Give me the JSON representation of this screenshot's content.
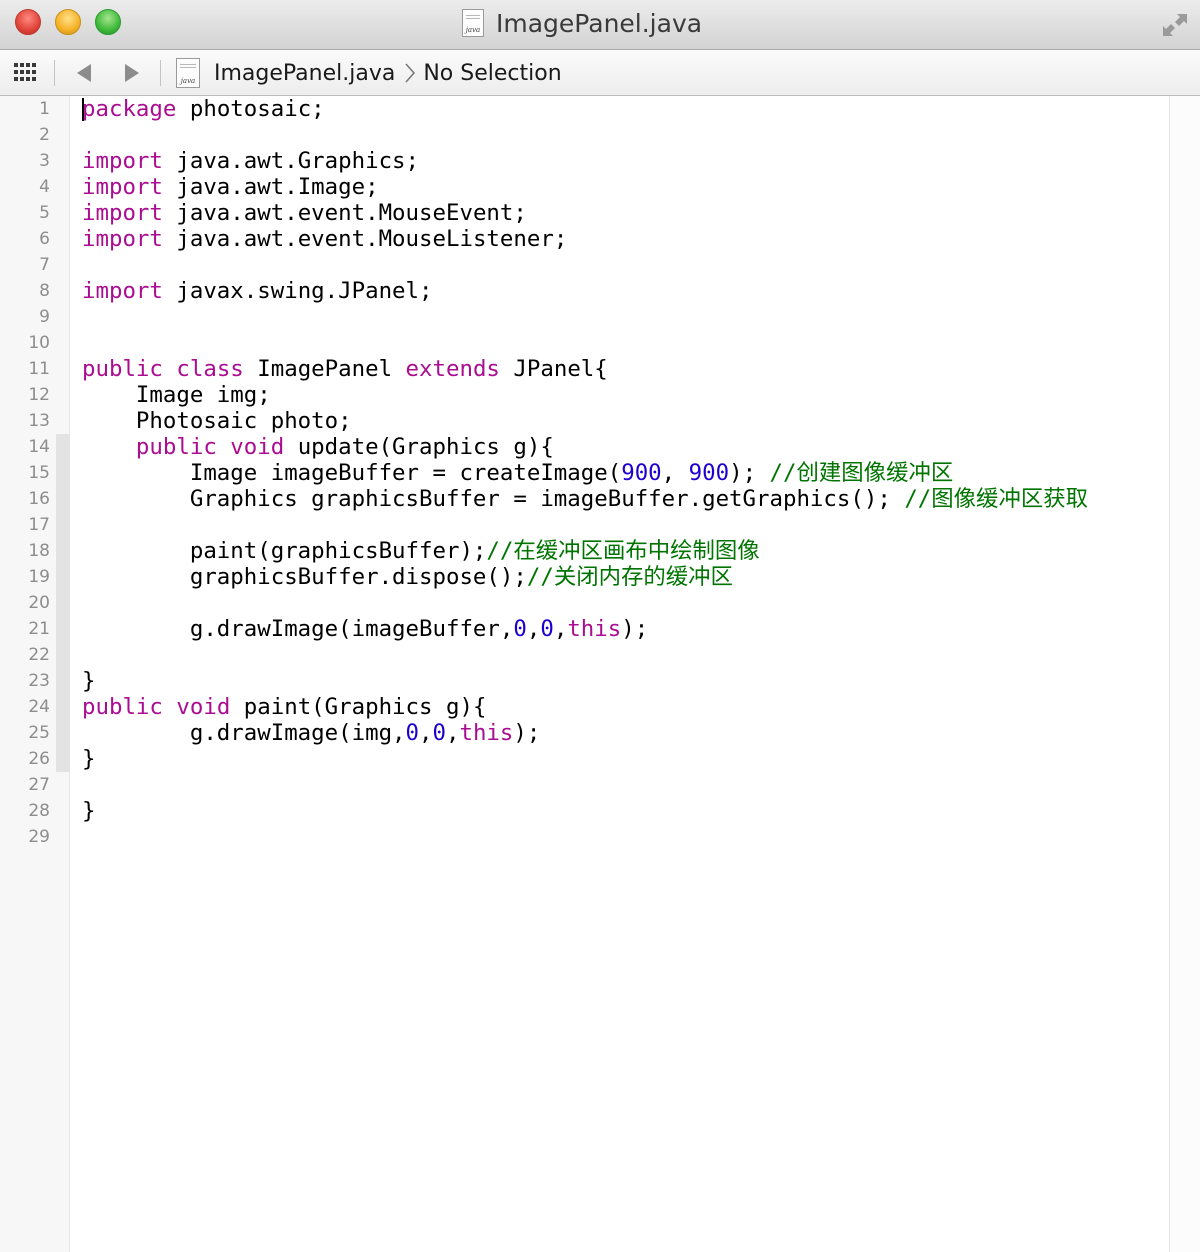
{
  "window": {
    "title": "ImagePanel.java",
    "file_icon_label": "java"
  },
  "jumpbar": {
    "file": "ImagePanel.java",
    "selection": "No Selection"
  },
  "colors": {
    "keyword": "#aa0d91",
    "number": "#1c00cf",
    "comment": "#007400",
    "text": "#000000",
    "line_number": "#8d8d8d"
  },
  "icons": {
    "close": "close-button-icon",
    "minimize": "minimize-button-icon",
    "zoom": "zoom-button-icon",
    "fullscreen": "fullscreen-arrows-icon",
    "related": "related-items-grid-icon",
    "back": "back-triangle-icon",
    "forward": "forward-triangle-icon",
    "file": "java-file-icon"
  },
  "editor": {
    "line_numbers": [
      "1",
      "2",
      "3",
      "4",
      "5",
      "6",
      "7",
      "8",
      "9",
      "10",
      "11",
      "12",
      "13",
      "14",
      "15",
      "16",
      "17",
      "18",
      "19",
      "20",
      "21",
      "22",
      "23",
      "24",
      "25",
      "26",
      "27",
      "28",
      "29"
    ],
    "lines": [
      [
        {
          "t": "kw",
          "v": "package"
        },
        {
          "t": "tx",
          "v": " photosaic;"
        }
      ],
      [],
      [
        {
          "t": "kw",
          "v": "import"
        },
        {
          "t": "tx",
          "v": " java.awt.Graphics;"
        }
      ],
      [
        {
          "t": "kw",
          "v": "import"
        },
        {
          "t": "tx",
          "v": " java.awt.Image;"
        }
      ],
      [
        {
          "t": "kw",
          "v": "import"
        },
        {
          "t": "tx",
          "v": " java.awt.event.MouseEvent;"
        }
      ],
      [
        {
          "t": "kw",
          "v": "import"
        },
        {
          "t": "tx",
          "v": " java.awt.event.MouseListener;"
        }
      ],
      [],
      [
        {
          "t": "kw",
          "v": "import"
        },
        {
          "t": "tx",
          "v": " javax.swing.JPanel;"
        }
      ],
      [],
      [],
      [
        {
          "t": "kw",
          "v": "public"
        },
        {
          "t": "tx",
          "v": " "
        },
        {
          "t": "kw",
          "v": "class"
        },
        {
          "t": "tx",
          "v": " ImagePanel "
        },
        {
          "t": "kw",
          "v": "extends"
        },
        {
          "t": "tx",
          "v": " JPanel{"
        }
      ],
      [
        {
          "t": "tx",
          "v": "    Image img;"
        }
      ],
      [
        {
          "t": "tx",
          "v": "    Photosaic photo;"
        }
      ],
      [
        {
          "t": "tx",
          "v": "    "
        },
        {
          "t": "kw",
          "v": "public"
        },
        {
          "t": "tx",
          "v": " "
        },
        {
          "t": "kw",
          "v": "void"
        },
        {
          "t": "tx",
          "v": " update(Graphics g){"
        }
      ],
      [
        {
          "t": "tx",
          "v": "        Image imageBuffer = createImage("
        },
        {
          "t": "num",
          "v": "900"
        },
        {
          "t": "tx",
          "v": ", "
        },
        {
          "t": "num",
          "v": "900"
        },
        {
          "t": "tx",
          "v": "); "
        },
        {
          "t": "cm",
          "v": "//创建图像缓冲区"
        }
      ],
      [
        {
          "t": "tx",
          "v": "        Graphics graphicsBuffer = imageBuffer.getGraphics(); "
        },
        {
          "t": "cm",
          "v": "//图像缓冲区获取"
        }
      ],
      [],
      [
        {
          "t": "tx",
          "v": "        paint(graphicsBuffer);"
        },
        {
          "t": "cm",
          "v": "//在缓冲区画布中绘制图像"
        }
      ],
      [
        {
          "t": "tx",
          "v": "        graphicsBuffer.dispose();"
        },
        {
          "t": "cm",
          "v": "//关闭内存的缓冲区"
        }
      ],
      [],
      [
        {
          "t": "tx",
          "v": "        g.drawImage(imageBuffer,"
        },
        {
          "t": "num",
          "v": "0"
        },
        {
          "t": "tx",
          "v": ","
        },
        {
          "t": "num",
          "v": "0"
        },
        {
          "t": "tx",
          "v": ","
        },
        {
          "t": "kw",
          "v": "this"
        },
        {
          "t": "tx",
          "v": ");"
        }
      ],
      [],
      [
        {
          "t": "tx",
          "v": "}"
        }
      ],
      [
        {
          "t": "kw",
          "v": "public"
        },
        {
          "t": "tx",
          "v": " "
        },
        {
          "t": "kw",
          "v": "void"
        },
        {
          "t": "tx",
          "v": " paint(Graphics g){"
        }
      ],
      [
        {
          "t": "tx",
          "v": "        g.drawImage(img,"
        },
        {
          "t": "num",
          "v": "0"
        },
        {
          "t": "tx",
          "v": ","
        },
        {
          "t": "num",
          "v": "0"
        },
        {
          "t": "tx",
          "v": ","
        },
        {
          "t": "kw",
          "v": "this"
        },
        {
          "t": "tx",
          "v": ");"
        }
      ],
      [
        {
          "t": "tx",
          "v": "}"
        }
      ],
      [],
      [
        {
          "t": "tx",
          "v": "}"
        }
      ],
      []
    ]
  }
}
